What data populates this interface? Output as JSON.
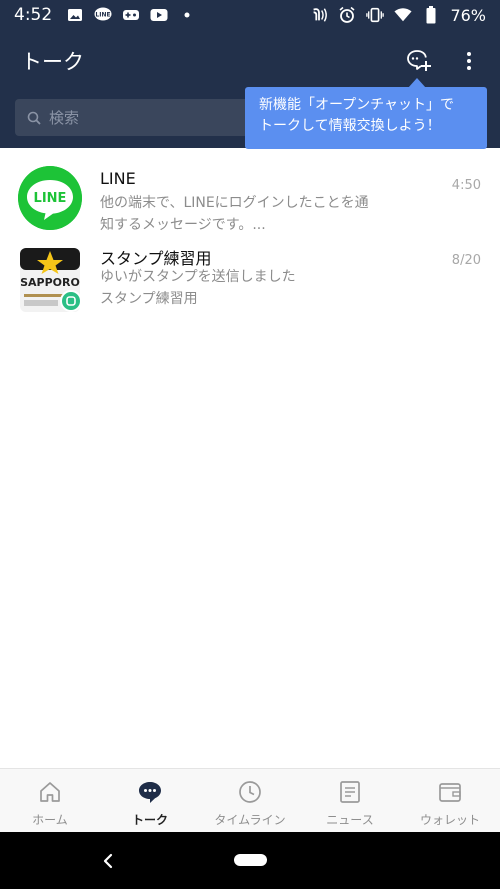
{
  "status_bar": {
    "time": "4:52",
    "battery": "76%",
    "icons_left": [
      "gallery-icon",
      "line-notification-icon",
      "game-icon",
      "youtube-icon",
      "dot-icon"
    ],
    "icons_right": [
      "nfc-icon",
      "alarm-icon",
      "vibrate-icon",
      "wifi-icon",
      "battery-icon"
    ]
  },
  "header": {
    "title": "トーク",
    "search_placeholder": "検索",
    "background_color": "#22304a"
  },
  "tooltip": {
    "line1": "新機能「オープンチャット」で",
    "line2": "トークして情報交換しよう！",
    "color": "#5b8ff0"
  },
  "chats": [
    {
      "name": "LINE",
      "preview_line1": "他の端末で、LINEにログインしたことを通",
      "preview_line2": "知するメッセージです。...",
      "time": "4:50",
      "avatar_text": "LINE"
    },
    {
      "name": "スタンプ練習用",
      "preview_line1": "ゆいがスタンプを送信しました",
      "preview_line2": "スタンプ練習用",
      "time": "8/20",
      "avatar_text": "SAPPORO"
    }
  ],
  "bottom_nav": [
    {
      "label": "ホーム",
      "icon": "home-icon",
      "active": false
    },
    {
      "label": "トーク",
      "icon": "talk-icon",
      "active": true
    },
    {
      "label": "タイムライン",
      "icon": "clock-icon",
      "active": false
    },
    {
      "label": "ニュース",
      "icon": "news-icon",
      "active": false
    },
    {
      "label": "ウォレット",
      "icon": "wallet-icon",
      "active": false
    }
  ]
}
